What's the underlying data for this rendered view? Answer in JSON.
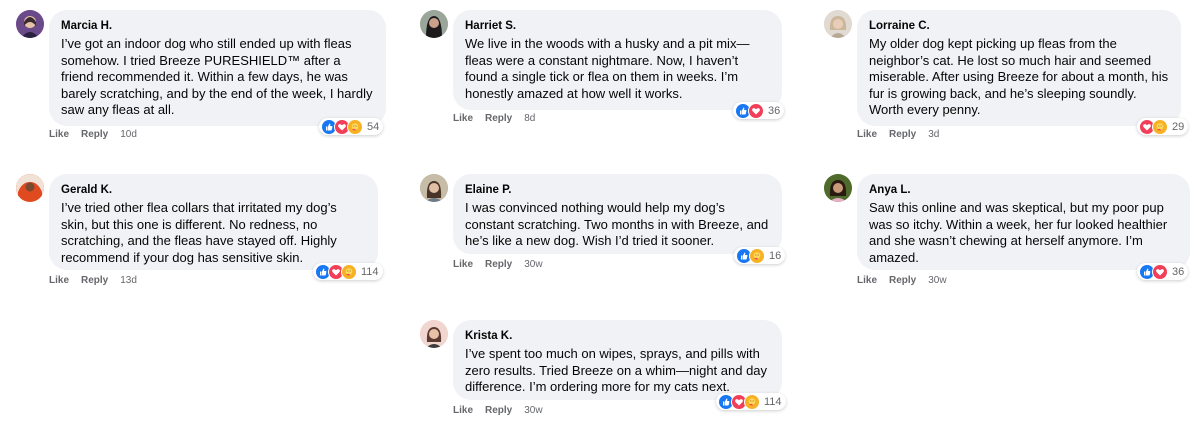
{
  "actions": {
    "like": "Like",
    "reply": "Reply"
  },
  "comments": [
    {
      "name": "Marcia H.",
      "text": "I’ve got an indoor dog who still ended up with fleas somehow. I tried Breeze PURESHIELD™ after a friend recommended it. Within a few days, he was barely scratching, and by the end of the week, I hardly saw any fleas at all.",
      "time": "10d",
      "reactions": [
        "like",
        "love",
        "care"
      ],
      "count": "54"
    },
    {
      "name": "Harriet S.",
      "text": "We live in the woods with a husky and a pit mix—fleas were a constant nightmare. Now, I haven’t found a single tick or flea on them in weeks. I’m honestly amazed at how well it works.",
      "time": "8d",
      "reactions": [
        "like",
        "love"
      ],
      "count": "36"
    },
    {
      "name": "Lorraine C.",
      "text": "My older dog kept picking up fleas from the neighbor’s cat. He lost so much hair and seemed miserable. After using Breeze for about a month, his fur is growing back, and he’s sleeping soundly. Worth every penny.",
      "time": "3d",
      "reactions": [
        "love",
        "care"
      ],
      "count": "29"
    },
    {
      "name": "Gerald K.",
      "text": "I’ve tried other flea collars that irritated my dog’s skin, but this one is different. No redness, no scratching, and the fleas have stayed off. Highly recommend if your dog has sensitive skin.",
      "time": "13d",
      "reactions": [
        "like",
        "love",
        "care"
      ],
      "count": "114"
    },
    {
      "name": "Elaine P.",
      "text": "I was convinced nothing would help my dog’s constant scratching. Two months in with Breeze, and he’s like a new dog. Wish I’d tried it sooner.",
      "time": "30w",
      "reactions": [
        "like",
        "care"
      ],
      "count": "16"
    },
    {
      "name": "Anya L.",
      "text": "Saw this online and was skeptical, but my poor pup was so itchy. Within a week, her fur looked healthier and she wasn’t chewing at herself anymore. I’m amazed.",
      "time": "30w",
      "reactions": [
        "like",
        "love"
      ],
      "count": "36"
    },
    {
      "name": "Krista K.",
      "text": "I’ve spent too much on wipes, sprays, and pills with zero results. Tried Breeze on a whim—night and day difference. I’m ordering more for my cats next.",
      "time": "30w",
      "reactions": [
        "like",
        "love",
        "care"
      ],
      "count": "114"
    }
  ]
}
